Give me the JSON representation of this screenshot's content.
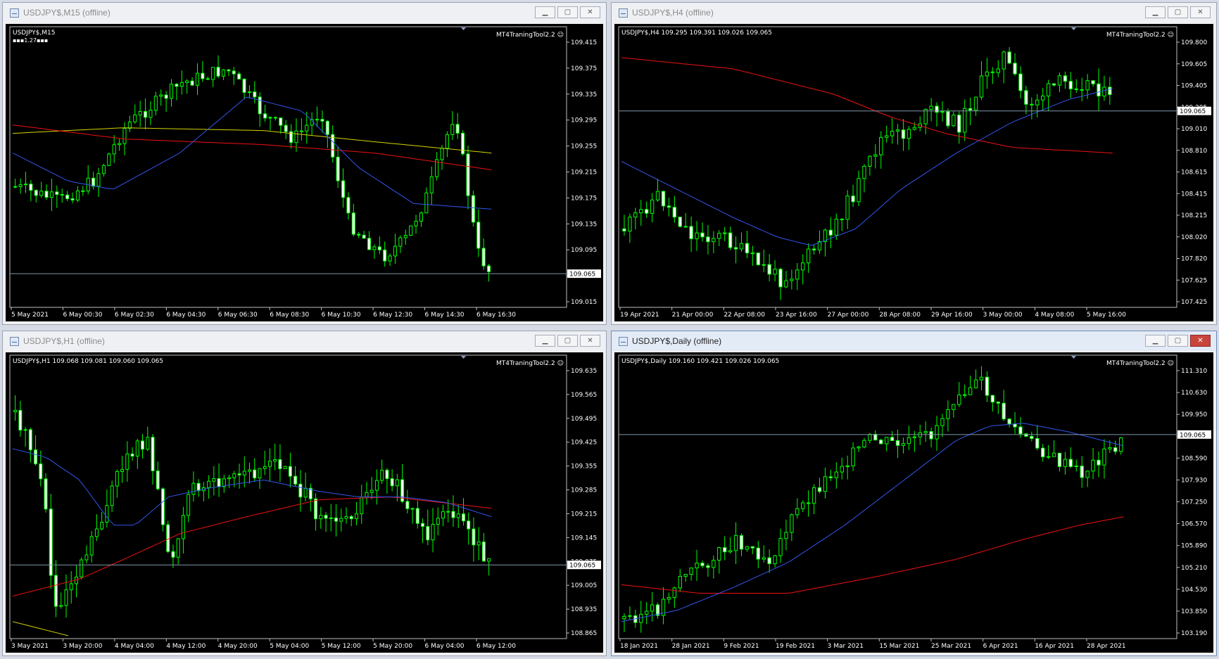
{
  "colors": {
    "bull": "#00ff00",
    "bear_body": "#ffffff",
    "grid": "#c0c0c0",
    "text": "#ffffff",
    "ma_blue": "#3355ee",
    "ma_red": "#ee1111",
    "ma_yellow": "#d4d400",
    "price_line": "#7f97a9",
    "price_label_bg": "#ffffff",
    "price_label_fg": "#000000"
  },
  "windows": [
    {
      "id": "m15",
      "title": "USDJPY$,M15 (offline)",
      "active": false,
      "header": "USDJPY$,M15",
      "subheader": "▪▪▪1.27▪▪▪",
      "ea_label": "MT4TraningTool2.2 ☺",
      "current_price": "109.065",
      "y_ticks": [
        "109.415",
        "109.375",
        "109.335",
        "109.295",
        "109.255",
        "109.215",
        "109.175",
        "109.135",
        "109.095",
        "109.055",
        "109.015"
      ],
      "x_ticks": [
        "5 May 2021",
        "6 May 00:30",
        "6 May 02:30",
        "6 May 04:30",
        "6 May 06:30",
        "6 May 08:30",
        "6 May 10:30",
        "6 May 12:30",
        "6 May 14:30",
        "6 May 16:30"
      ]
    },
    {
      "id": "h4",
      "title": "USDJPY$,H4 (offline)",
      "active": false,
      "header": "USDJPY$,H4  109.295 109.391 109.026 109.065",
      "subheader": "",
      "ea_label": "MT4TraningTool2.2 ☺",
      "current_price": "109.065",
      "y_ticks": [
        "109.800",
        "109.605",
        "109.405",
        "109.205",
        "109.010",
        "108.810",
        "108.615",
        "108.415",
        "108.215",
        "108.020",
        "107.820",
        "107.625",
        "107.425"
      ],
      "x_ticks": [
        "19 Apr 2021",
        "21 Apr 00:00",
        "22 Apr 08:00",
        "23 Apr 16:00",
        "27 Apr 00:00",
        "28 Apr 08:00",
        "29 Apr 16:00",
        "3 May 00:00",
        "4 May 08:00",
        "5 May 16:00"
      ]
    },
    {
      "id": "h1",
      "title": "USDJPY$,H1 (offline)",
      "active": false,
      "header": "USDJPY$,H1  109.068 109.081 109.060 109.065",
      "subheader": "",
      "ea_label": "MT4TraningTool2.2 ☺",
      "current_price": "109.065",
      "y_ticks": [
        "109.635",
        "109.565",
        "109.495",
        "109.425",
        "109.355",
        "109.285",
        "109.215",
        "109.145",
        "109.075",
        "109.005",
        "108.935",
        "108.865"
      ],
      "x_ticks": [
        "3 May 2021",
        "3 May 20:00",
        "4 May 04:00",
        "4 May 12:00",
        "4 May 20:00",
        "5 May 04:00",
        "5 May 12:00",
        "5 May 20:00",
        "6 May 04:00",
        "6 May 12:00"
      ]
    },
    {
      "id": "d1",
      "title": "USDJPY$,Daily (offline)",
      "active": true,
      "header": "USDJPY$,Daily  109.160 109.421 109.026 109.065",
      "subheader": "",
      "ea_label": "MT4TraningTool2.2 ☺",
      "current_price": "109.065",
      "y_ticks": [
        "111.310",
        "110.630",
        "109.950",
        "109.270",
        "108.590",
        "107.930",
        "107.250",
        "106.570",
        "105.890",
        "105.210",
        "104.530",
        "103.850",
        "103.190"
      ],
      "x_ticks": [
        "18 Jan 2021",
        "28 Jan 2021",
        "9 Feb 2021",
        "19 Feb 2021",
        "3 Mar 2021",
        "15 Mar 2021",
        "25 Mar 2021",
        "6 Apr 2021",
        "16 Apr 2021",
        "28 Apr 2021"
      ]
    }
  ]
}
